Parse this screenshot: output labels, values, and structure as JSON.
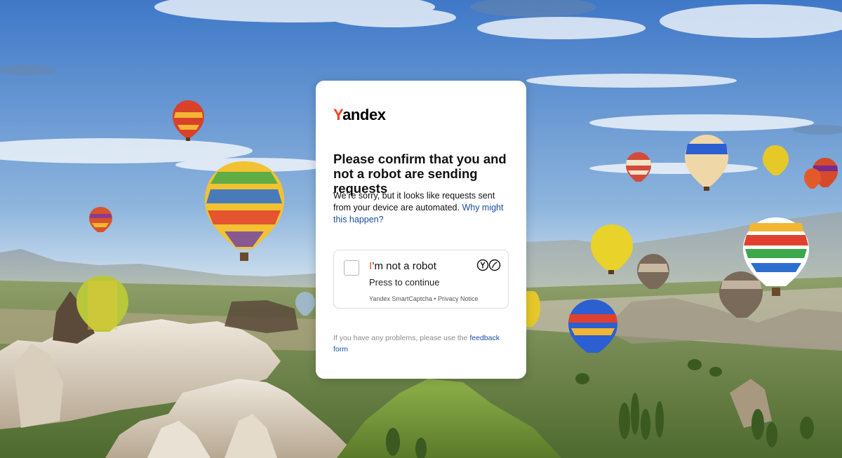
{
  "logo": {
    "first_letter": "Y",
    "rest": "andex"
  },
  "headline": "Please confirm that you and not a robot are sending requests",
  "description": {
    "text": "We’re sorry, but it looks like requests sent from your device are automated. ",
    "link": "Why might this happen?"
  },
  "captcha": {
    "title_first": "I",
    "title_rest": "’m not a robot",
    "subtitle": "Press to continue",
    "footer": "Yandex SmartCaptcha • Privacy Notice",
    "icons": [
      "yandex-circle-icon",
      "speed-circle-icon"
    ]
  },
  "problems": {
    "text": "If you have any problems, please use the ",
    "link": "feedback form"
  },
  "colors": {
    "brand_red": "#fc3f1d",
    "link_blue": "#1a4d9e",
    "sky_top": "#3f78c8",
    "sky_bottom": "#cfe0ee"
  }
}
